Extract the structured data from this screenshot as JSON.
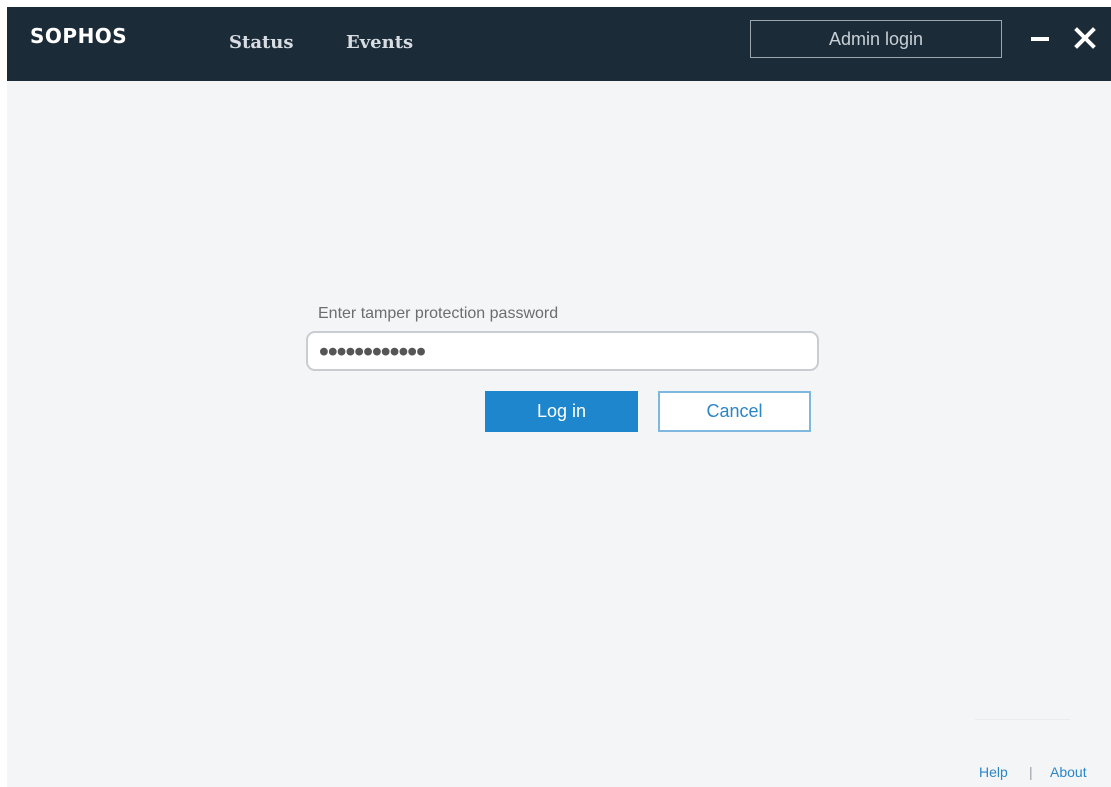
{
  "header": {
    "logo": "SOPHOS",
    "tabs": [
      {
        "label": "Status"
      },
      {
        "label": "Events"
      }
    ],
    "admin_login_label": "Admin login"
  },
  "login": {
    "field_label": "Enter tamper protection password",
    "password_masked": "●●●●●●●●●●●●",
    "login_label": "Log in",
    "cancel_label": "Cancel"
  },
  "footer": {
    "help_label": "Help",
    "separator": "|",
    "about_label": "About"
  },
  "colors": {
    "titlebar": "#1c2b38",
    "background": "#f4f5f7",
    "accent": "#1d86cc"
  },
  "icons": {
    "minimize": "minimize-icon",
    "close": "close-icon"
  }
}
